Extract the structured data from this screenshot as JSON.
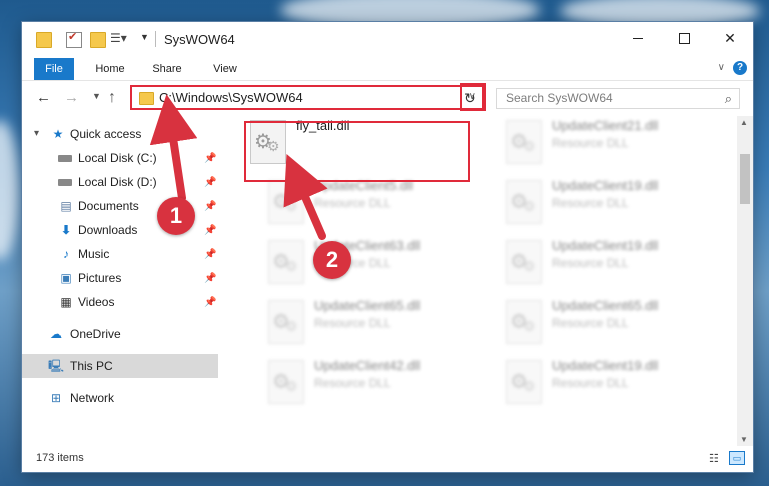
{
  "window": {
    "title": "SysWOW64"
  },
  "ribbon": {
    "tabs": [
      {
        "label": "File"
      },
      {
        "label": "Home"
      },
      {
        "label": "Share"
      },
      {
        "label": "View"
      }
    ]
  },
  "navigation": {
    "address": "C:\\Windows\\SysWOW64",
    "search_placeholder": "Search SysWOW64"
  },
  "sidebar": {
    "items": [
      {
        "label": "Quick access",
        "icon": "star-icon"
      },
      {
        "label": "Local Disk (C:)",
        "icon": "drive-icon",
        "pinned": true
      },
      {
        "label": "Local Disk (D:)",
        "icon": "drive-icon",
        "pinned": true
      },
      {
        "label": "Documents",
        "icon": "documents-icon",
        "pinned": true
      },
      {
        "label": "Downloads",
        "icon": "download-icon",
        "pinned": true
      },
      {
        "label": "Music",
        "icon": "music-icon",
        "pinned": true
      },
      {
        "label": "Pictures",
        "icon": "pictures-icon",
        "pinned": true
      },
      {
        "label": "Videos",
        "icon": "videos-icon",
        "pinned": true
      },
      {
        "label": "OneDrive",
        "icon": "cloud-icon"
      },
      {
        "label": "This PC",
        "icon": "computer-icon",
        "selected": true
      },
      {
        "label": "Network",
        "icon": "network-icon"
      }
    ]
  },
  "files": {
    "main": {
      "name": "fly_tail.dll",
      "type": ""
    },
    "blurred": [
      {
        "name": "UpdateClient21.dll",
        "type": "Resource DLL"
      },
      {
        "name": "UpdateClient5.dll",
        "type": "Resource DLL"
      },
      {
        "name": "UpdateClient19.dll",
        "type": "Resource DLL"
      },
      {
        "name": "UpdateClient63.dll",
        "type": "Resource DLL"
      },
      {
        "name": "UpdateClient19.dll",
        "type": "Resource DLL"
      },
      {
        "name": "UpdateClient65.dll",
        "type": "Resource DLL"
      },
      {
        "name": "UpdateClient65.dll",
        "type": "Resource DLL"
      },
      {
        "name": "UpdateClient42.dll",
        "type": "Resource DLL"
      },
      {
        "name": "UpdateClient19.dll",
        "type": "Resource DLL"
      }
    ]
  },
  "status": {
    "count": "173 items"
  },
  "callouts": [
    "1",
    "2"
  ],
  "colors": {
    "accent": "#1979ca",
    "highlight": "#e02a3a",
    "callout": "#d8323f"
  }
}
